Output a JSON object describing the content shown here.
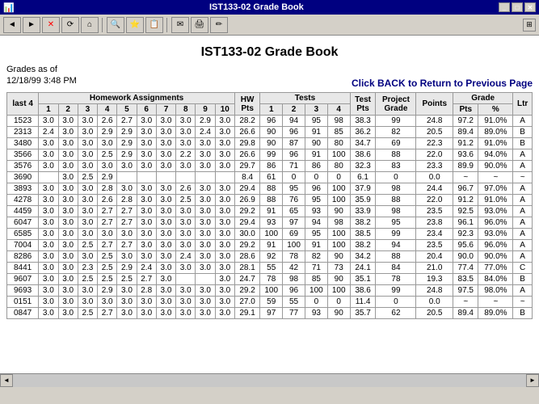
{
  "titlebar": {
    "title": "IST133-02 Grade Book"
  },
  "toolbar": {
    "buttons": [
      "◄",
      "►",
      "✕",
      "⌂",
      "🔍",
      "⌂",
      "🔍",
      "⭐",
      "📄",
      "🖨",
      "✉",
      "📋",
      "✏"
    ]
  },
  "page": {
    "title": "IST133-02 Grade Book",
    "grades_label": "Grades as of",
    "grades_date": "12/18/99 3:48 PM",
    "back_link": "Click  BACK  to Return to  Previous Page"
  },
  "table": {
    "headers": {
      "col1": "last 4",
      "hw_section": "Homework Assignments",
      "hw_nums": [
        "1",
        "2",
        "3",
        "4",
        "5",
        "6",
        "7",
        "8",
        "9",
        "10"
      ],
      "hw_pts": "HW Pts",
      "tests_section": "Tests",
      "test_nums": [
        "1",
        "2",
        "3",
        "4"
      ],
      "test_pts": "Test Pts",
      "project_grade": "Grade",
      "project_points": "Points",
      "grade_pts": "Pts",
      "grade_pct": "%",
      "grade_ltr": "Ltr"
    },
    "rows": [
      {
        "id": "1523",
        "hw": [
          "3.0",
          "3.0",
          "3.0",
          "2.6",
          "2.7",
          "3.0",
          "3.0",
          "3.0",
          "2.9",
          "3.0"
        ],
        "hwpts": "28.2",
        "tests": [
          "96",
          "94",
          "95",
          "98"
        ],
        "testpts": "38.3",
        "grade": "99",
        "points": "24.8",
        "pts": "97.2",
        "pct": "91.0%",
        "ltr": "A"
      },
      {
        "id": "2313",
        "hw": [
          "2.4",
          "3.0",
          "3.0",
          "2.9",
          "2.9",
          "3.0",
          "3.0",
          "3.0",
          "2.4",
          "3.0"
        ],
        "hwpts": "26.6",
        "tests": [
          "90",
          "96",
          "91",
          "85"
        ],
        "testpts": "36.2",
        "grade": "82",
        "points": "20.5",
        "pts": "89.4",
        "pct": "89.0%",
        "ltr": "B"
      },
      {
        "id": "3480",
        "hw": [
          "3.0",
          "3.0",
          "3.0",
          "3.0",
          "2.9",
          "3.0",
          "3.0",
          "3.0",
          "3.0",
          "3.0"
        ],
        "hwpts": "29.8",
        "tests": [
          "90",
          "87",
          "90",
          "80"
        ],
        "testpts": "34.7",
        "grade": "69",
        "points": "22.3",
        "pts": "91.2",
        "pct": "91.0%",
        "ltr": "B"
      },
      {
        "id": "3566",
        "hw": [
          "3.0",
          "3.0",
          "3.0",
          "2.5",
          "2.9",
          "3.0",
          "3.0",
          "2.2",
          "3.0",
          "3.0"
        ],
        "hwpts": "26.6",
        "tests": [
          "99",
          "96",
          "91",
          "100"
        ],
        "testpts": "38.6",
        "grade": "88",
        "points": "22.0",
        "pts": "93.6",
        "pct": "94.0%",
        "ltr": "A"
      },
      {
        "id": "3576",
        "hw": [
          "3.0",
          "3.0",
          "3.0",
          "3.0",
          "3.0",
          "3.0",
          "3.0",
          "3.0",
          "3.0",
          "3.0"
        ],
        "hwpts": "29.7",
        "tests": [
          "86",
          "71",
          "86",
          "80"
        ],
        "testpts": "32.3",
        "grade": "83",
        "points": "23.3",
        "pts": "89.9",
        "pct": "90.0%",
        "ltr": "A"
      },
      {
        "id": "3690",
        "hw": [
          "",
          "3.0",
          "2.5",
          "2.9",
          "",
          "",
          "",
          "",
          "",
          ""
        ],
        "hwpts": "8.4",
        "tests": [
          "61",
          "0",
          "0",
          "0"
        ],
        "testpts": "6.1",
        "grade": "0",
        "points": "0.0",
        "pts": "~",
        "pct": "~",
        "ltr": "~"
      },
      {
        "id": "3893",
        "hw": [
          "3.0",
          "3.0",
          "3.0",
          "2.8",
          "3.0",
          "3.0",
          "3.0",
          "2.6",
          "3.0",
          "3.0"
        ],
        "hwpts": "29.4",
        "tests": [
          "88",
          "95",
          "96",
          "100"
        ],
        "testpts": "37.9",
        "grade": "98",
        "points": "24.4",
        "pts": "96.7",
        "pct": "97.0%",
        "ltr": "A"
      },
      {
        "id": "4278",
        "hw": [
          "3.0",
          "3.0",
          "3.0",
          "2.6",
          "2.8",
          "3.0",
          "3.0",
          "2.5",
          "3.0",
          "3.0"
        ],
        "hwpts": "26.9",
        "tests": [
          "88",
          "76",
          "95",
          "100"
        ],
        "testpts": "35.9",
        "grade": "88",
        "points": "22.0",
        "pts": "91.2",
        "pct": "91.0%",
        "ltr": "A"
      },
      {
        "id": "4459",
        "hw": [
          "3.0",
          "3.0",
          "3.0",
          "2.7",
          "2.7",
          "3.0",
          "3.0",
          "3.0",
          "3.0",
          "3.0"
        ],
        "hwpts": "29.2",
        "tests": [
          "91",
          "65",
          "93",
          "90"
        ],
        "testpts": "33.9",
        "grade": "98",
        "points": "23.5",
        "pts": "92.5",
        "pct": "93.0%",
        "ltr": "A"
      },
      {
        "id": "6047",
        "hw": [
          "3.0",
          "3.0",
          "3.0",
          "2.7",
          "2.7",
          "3.0",
          "3.0",
          "3.0",
          "3.0",
          "3.0"
        ],
        "hwpts": "29.4",
        "tests": [
          "93",
          "97",
          "94",
          "98"
        ],
        "testpts": "38.2",
        "grade": "95",
        "points": "23.8",
        "pts": "96.1",
        "pct": "96.0%",
        "ltr": "A"
      },
      {
        "id": "6585",
        "hw": [
          "3.0",
          "3.0",
          "3.0",
          "3.0",
          "3.0",
          "3.0",
          "3.0",
          "3.0",
          "3.0",
          "3.0"
        ],
        "hwpts": "30.0",
        "tests": [
          "100",
          "69",
          "95",
          "100"
        ],
        "testpts": "38.5",
        "grade": "99",
        "points": "23.4",
        "pts": "92.3",
        "pct": "93.0%",
        "ltr": "A"
      },
      {
        "id": "7004",
        "hw": [
          "3.0",
          "3.0",
          "2.5",
          "2.7",
          "2.7",
          "3.0",
          "3.0",
          "3.0",
          "3.0",
          "3.0"
        ],
        "hwpts": "29.2",
        "tests": [
          "91",
          "100",
          "91",
          "100"
        ],
        "testpts": "38.2",
        "grade": "94",
        "points": "23.5",
        "pts": "95.6",
        "pct": "96.0%",
        "ltr": "A"
      },
      {
        "id": "8286",
        "hw": [
          "3.0",
          "3.0",
          "3.0",
          "2.5",
          "3.0",
          "3.0",
          "3.0",
          "2.4",
          "3.0",
          "3.0"
        ],
        "hwpts": "28.6",
        "tests": [
          "92",
          "78",
          "82",
          "90"
        ],
        "testpts": "34.2",
        "grade": "88",
        "points": "20.4",
        "pts": "90.0",
        "pct": "90.0%",
        "ltr": "A"
      },
      {
        "id": "8441",
        "hw": [
          "3.0",
          "3.0",
          "2.3",
          "2.5",
          "2.9",
          "2.4",
          "3.0",
          "3.0",
          "3.0",
          "3.0"
        ],
        "hwpts": "28.1",
        "tests": [
          "55",
          "42",
          "71",
          "73"
        ],
        "testpts": "24.1",
        "grade": "84",
        "points": "21.0",
        "pts": "77.4",
        "pct": "77.0%",
        "ltr": "C"
      },
      {
        "id": "9607",
        "hw": [
          "3.0",
          "3.0",
          "2.5",
          "2.5",
          "2.5",
          "2.7",
          "3.0",
          "",
          "",
          "3.0"
        ],
        "hwpts": "24.7",
        "tests": [
          "78",
          "98",
          "85",
          "90"
        ],
        "testpts": "35.1",
        "grade": "78",
        "points": "19.3",
        "pts": "83.5",
        "pct": "84.0%",
        "ltr": "B"
      },
      {
        "id": "9693",
        "hw": [
          "3.0",
          "3.0",
          "3.0",
          "2.9",
          "3.0",
          "2.8",
          "3.0",
          "3.0",
          "3.0",
          "3.0"
        ],
        "hwpts": "29.2",
        "tests": [
          "100",
          "96",
          "100",
          "100"
        ],
        "testpts": "38.6",
        "grade": "99",
        "points": "24.8",
        "pts": "97.5",
        "pct": "98.0%",
        "ltr": "A"
      },
      {
        "id": "0151",
        "hw": [
          "3.0",
          "3.0",
          "3.0",
          "3.0",
          "3.0",
          "3.0",
          "3.0",
          "3.0",
          "3.0",
          "3.0"
        ],
        "hwpts": "27.0",
        "tests": [
          "59",
          "55",
          "0",
          "0"
        ],
        "testpts": "11.4",
        "grade": "0",
        "points": "0.0",
        "pts": "~",
        "pct": "~",
        "ltr": "~"
      },
      {
        "id": "0847",
        "hw": [
          "3.0",
          "3.0",
          "2.5",
          "2.7",
          "3.0",
          "3.0",
          "3.0",
          "3.0",
          "3.0",
          "3.0"
        ],
        "hwpts": "29.1",
        "tests": [
          "97",
          "77",
          "93",
          "90"
        ],
        "testpts": "35.7",
        "grade": "62",
        "points": "20.5",
        "pts": "89.4",
        "pct": "89.0%",
        "ltr": "B"
      }
    ]
  },
  "statusbar": {
    "text": ""
  }
}
